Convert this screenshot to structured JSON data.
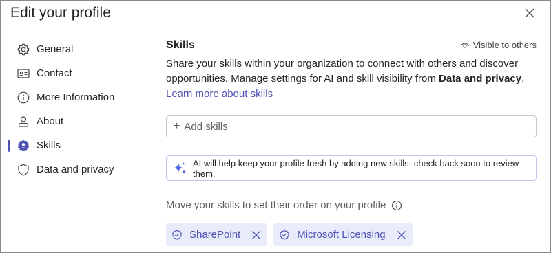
{
  "dialog": {
    "title": "Edit your profile",
    "close_icon": "close-icon"
  },
  "nav": {
    "items": [
      {
        "label": "General",
        "icon": "gear-icon"
      },
      {
        "label": "Contact",
        "icon": "contact-card-icon"
      },
      {
        "label": "More Information",
        "icon": "info-icon"
      },
      {
        "label": "About",
        "icon": "person-icon"
      },
      {
        "label": "Skills",
        "icon": "skills-icon",
        "active": true
      },
      {
        "label": "Data and privacy",
        "icon": "shield-icon"
      }
    ]
  },
  "skills": {
    "title": "Skills",
    "visibility": "Visible to others",
    "description_part1": "Share your skills within your organization to connect with others and discover opportunities. Manage settings for AI and skill visibility from ",
    "description_bold": "Data and privacy",
    "description_part2": ".",
    "learn_more": "Learn more about skills",
    "add_placeholder": "Add skills",
    "ai_notice": "AI will help keep your profile fresh by adding new skills, check back soon to review them.",
    "order_label": "Move your skills to set their order on your profile",
    "pills": [
      {
        "label": "SharePoint"
      },
      {
        "label": "Microsoft Licensing"
      }
    ]
  },
  "colors": {
    "accent": "#4f52b2",
    "pill_bg": "#e8ebfa",
    "ai_border": "#c5c4f0"
  }
}
